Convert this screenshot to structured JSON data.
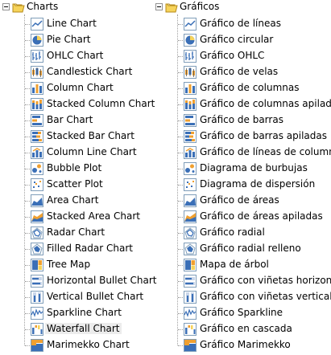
{
  "left_tree": {
    "root": {
      "label": "Charts",
      "icon": "folder-open-icon"
    },
    "items": [
      {
        "label": "Line Chart",
        "icon": "line-chart-icon"
      },
      {
        "label": "Pie Chart",
        "icon": "pie-chart-icon"
      },
      {
        "label": "OHLC Chart",
        "icon": "ohlc-chart-icon"
      },
      {
        "label": "Candlestick Chart",
        "icon": "candlestick-chart-icon"
      },
      {
        "label": "Column Chart",
        "icon": "column-chart-icon"
      },
      {
        "label": "Stacked Column Chart",
        "icon": "stacked-column-chart-icon"
      },
      {
        "label": "Bar Chart",
        "icon": "bar-chart-icon"
      },
      {
        "label": "Stacked Bar Chart",
        "icon": "stacked-bar-chart-icon"
      },
      {
        "label": "Column Line Chart",
        "icon": "column-line-chart-icon"
      },
      {
        "label": "Bubble Plot",
        "icon": "bubble-plot-icon"
      },
      {
        "label": "Scatter Plot",
        "icon": "scatter-plot-icon"
      },
      {
        "label": "Area Chart",
        "icon": "area-chart-icon"
      },
      {
        "label": "Stacked Area Chart",
        "icon": "stacked-area-chart-icon"
      },
      {
        "label": "Radar Chart",
        "icon": "radar-chart-icon"
      },
      {
        "label": "Filled Radar Chart",
        "icon": "filled-radar-chart-icon"
      },
      {
        "label": "Tree Map",
        "icon": "tree-map-icon"
      },
      {
        "label": "Horizontal Bullet Chart",
        "icon": "horizontal-bullet-chart-icon"
      },
      {
        "label": "Vertical Bullet Chart",
        "icon": "vertical-bullet-chart-icon"
      },
      {
        "label": "Sparkline Chart",
        "icon": "sparkline-chart-icon"
      },
      {
        "label": "Waterfall Chart",
        "icon": "waterfall-chart-icon",
        "selected": true
      },
      {
        "label": "Marimekko Chart",
        "icon": "marimekko-chart-icon"
      }
    ]
  },
  "right_tree": {
    "root": {
      "label": "Gráficos",
      "icon": "folder-open-icon"
    },
    "items": [
      {
        "label": "Gráfico de líneas",
        "icon": "line-chart-icon"
      },
      {
        "label": "Gráfico circular",
        "icon": "pie-chart-icon"
      },
      {
        "label": "Gráfico OHLC",
        "icon": "ohlc-chart-icon"
      },
      {
        "label": "Gráfico de velas",
        "icon": "candlestick-chart-icon"
      },
      {
        "label": "Gráfico de columnas",
        "icon": "column-chart-icon"
      },
      {
        "label": "Gráfico de columnas apiladas",
        "icon": "stacked-column-chart-icon"
      },
      {
        "label": "Gráfico de barras",
        "icon": "bar-chart-icon"
      },
      {
        "label": "Gráfico de barras apiladas",
        "icon": "stacked-bar-chart-icon"
      },
      {
        "label": "Gráfico de líneas de columnas",
        "icon": "column-line-chart-icon"
      },
      {
        "label": "Diagrama de burbujas",
        "icon": "bubble-plot-icon"
      },
      {
        "label": "Diagrama de dispersión",
        "icon": "scatter-plot-icon"
      },
      {
        "label": "Gráfico de áreas",
        "icon": "area-chart-icon"
      },
      {
        "label": "Gráfico de áreas apiladas",
        "icon": "stacked-area-chart-icon"
      },
      {
        "label": "Gráfico radial",
        "icon": "radar-chart-icon"
      },
      {
        "label": "Gráfico radial relleno",
        "icon": "filled-radar-chart-icon"
      },
      {
        "label": "Mapa de árbol",
        "icon": "tree-map-icon"
      },
      {
        "label": "Gráfico con viñetas horizontal",
        "icon": "horizontal-bullet-chart-icon"
      },
      {
        "label": "Gráfico con viñetas vertical",
        "icon": "vertical-bullet-chart-icon"
      },
      {
        "label": "Gráfico Sparkline",
        "icon": "sparkline-chart-icon"
      },
      {
        "label": "Gráfico en cascada",
        "icon": "waterfall-chart-icon"
      },
      {
        "label": "Gráfico Marimekko",
        "icon": "marimekko-chart-icon"
      }
    ]
  },
  "colors": {
    "icon_blue": "#3a6fb7",
    "icon_orange": "#f0a030",
    "icon_yellow": "#f6d35a",
    "icon_border": "#7f9db9",
    "selected_bg": "#ececec",
    "tree_line": "#a0a0a0"
  }
}
